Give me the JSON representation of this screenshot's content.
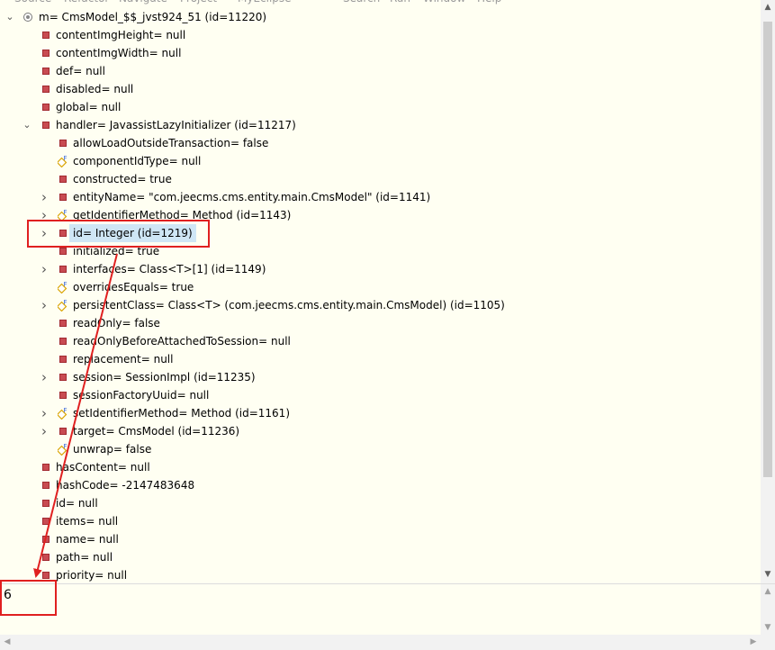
{
  "menu_bar": [
    "Source",
    "Refactor",
    "Navigate",
    "Project",
    "MyEclipse",
    "Search",
    "Run",
    "Window",
    "Help"
  ],
  "tree": {
    "rows": [
      {
        "text": "m= CmsModel_$$_jvst924_51  (id=11220)",
        "icon": "local-variable-icon",
        "twistie": "expanded"
      },
      {
        "text": "contentImgHeight= null",
        "icon": "field-icon"
      },
      {
        "text": "contentImgWidth= null",
        "icon": "field-icon"
      },
      {
        "text": "def= null",
        "icon": "field-icon"
      },
      {
        "text": "disabled= null",
        "icon": "field-icon"
      },
      {
        "text": "global= null",
        "icon": "field-icon"
      },
      {
        "text": "handler= JavassistLazyInitializer  (id=11217)",
        "icon": "field-icon",
        "twistie": "expanded"
      },
      {
        "text": "allowLoadOutsideTransaction= false",
        "icon": "field-icon"
      },
      {
        "text": "componentIdType= null",
        "icon": "final-field-icon"
      },
      {
        "text": "constructed= true",
        "icon": "field-icon"
      },
      {
        "text": "entityName= \"com.jeecms.cms.entity.main.CmsModel\" (id=1141)",
        "icon": "field-icon",
        "twistie": "collapsed"
      },
      {
        "text": "getIdentifierMethod= Method  (id=1143)",
        "icon": "final-field-icon",
        "twistie": "collapsed"
      },
      {
        "text": "id= Integer  (id=1219)",
        "icon": "field-icon",
        "twistie": "collapsed",
        "selected": true
      },
      {
        "text": "initialized= true",
        "icon": "field-icon"
      },
      {
        "text": "interfaces= Class<T>[1]  (id=1149)",
        "icon": "field-icon",
        "twistie": "collapsed"
      },
      {
        "text": "overridesEquals= true",
        "icon": "final-field-icon"
      },
      {
        "text": "persistentClass= Class<T> (com.jeecms.cms.entity.main.CmsModel) (id=1105)",
        "icon": "final-field-icon",
        "twistie": "collapsed"
      },
      {
        "text": "readOnly= false",
        "icon": "field-icon"
      },
      {
        "text": "readOnlyBeforeAttachedToSession= null",
        "icon": "field-icon"
      },
      {
        "text": "replacement= null",
        "icon": "field-icon"
      },
      {
        "text": "session= SessionImpl  (id=11235)",
        "icon": "field-icon",
        "twistie": "collapsed"
      },
      {
        "text": "sessionFactoryUuid= null",
        "icon": "field-icon"
      },
      {
        "text": "setIdentifierMethod= Method  (id=1161)",
        "icon": "final-field-icon",
        "twistie": "collapsed"
      },
      {
        "text": "target= CmsModel  (id=11236)",
        "icon": "field-icon",
        "twistie": "collapsed"
      },
      {
        "text": "unwrap= false",
        "icon": "final-field-icon"
      },
      {
        "text": "hasContent= null",
        "icon": "field-icon"
      },
      {
        "text": "hashCode= -2147483648",
        "icon": "field-icon"
      },
      {
        "text": "id= null",
        "icon": "field-icon"
      },
      {
        "text": "items= null",
        "icon": "field-icon"
      },
      {
        "text": "name= null",
        "icon": "field-icon"
      },
      {
        "text": "path= null",
        "icon": "field-icon"
      },
      {
        "text": "priority= null",
        "icon": "field-icon"
      }
    ]
  },
  "detail_pane": {
    "value": "6"
  },
  "colors": {
    "background": "#fffff2",
    "field_icon": "#c84b52",
    "final_badge": "#d9a400",
    "selection": "#cfe6f5",
    "annotation": "#e02020"
  }
}
